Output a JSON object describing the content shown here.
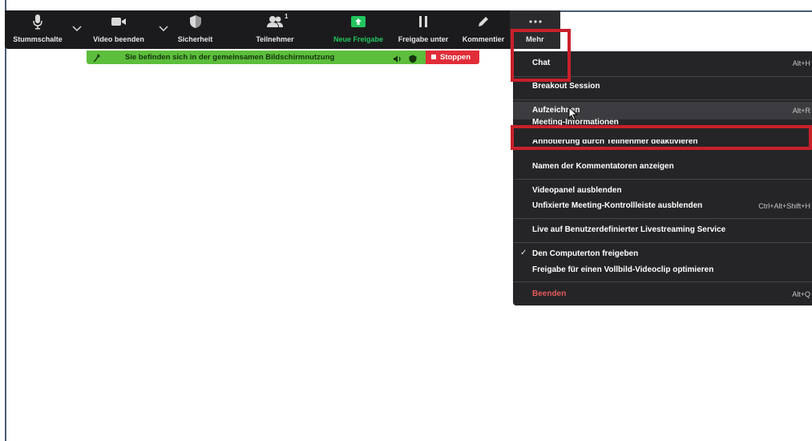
{
  "toolbar": {
    "mute_label": "Stummschalte",
    "video_label": "Video beenden",
    "security_label": "Sicherheit",
    "participants_label": "Teilnehmer",
    "participants_count": "1",
    "new_share_label": "Neue Freigabe",
    "pause_share_label": "Freigabe unter",
    "annotate_label": "Kommentier",
    "more_label": "Mehr"
  },
  "share_banner": {
    "text": "Sie befinden sich in der gemeinsamen Bildschirmnutzung",
    "stop_label": "Stoppen"
  },
  "menu": {
    "chat": {
      "label": "Chat",
      "shortcut": "Alt+H"
    },
    "breakout": {
      "label": "Breakout Session"
    },
    "record": {
      "label": "Aufzeichnen",
      "shortcut": "Alt+R"
    },
    "meeting_info": {
      "label": "Meeting-Informationen"
    },
    "disable_annotation": {
      "label": "Annotierung durch Teilnehmer deaktivieren"
    },
    "show_annotator_names": {
      "label": "Namen der Kommentatoren anzeigen"
    },
    "hide_video_panel": {
      "label": "Videopanel ausblenden"
    },
    "hide_floating_controls": {
      "label": "Unfixierte Meeting-Kontrollleiste ausblenden",
      "shortcut": "Ctrl+Alt+Shift+H"
    },
    "live_stream": {
      "label": "Live auf Benutzerdefinierter Livestreaming Service"
    },
    "share_computer_sound": {
      "label": "Den Computerton freigeben",
      "checked": true
    },
    "optimize_video": {
      "label": "Freigabe für einen Vollbild-Videoclip optimieren"
    },
    "end": {
      "label": "Beenden",
      "shortcut": "Alt+Q"
    }
  },
  "colors": {
    "toolbar_bg": "#1b1b1d",
    "menu_bg": "#252528",
    "share_green": "#5cbe3c",
    "new_share_green": "#22c55e",
    "stop_red": "#e02d38",
    "annotation_red": "#c8202a"
  }
}
